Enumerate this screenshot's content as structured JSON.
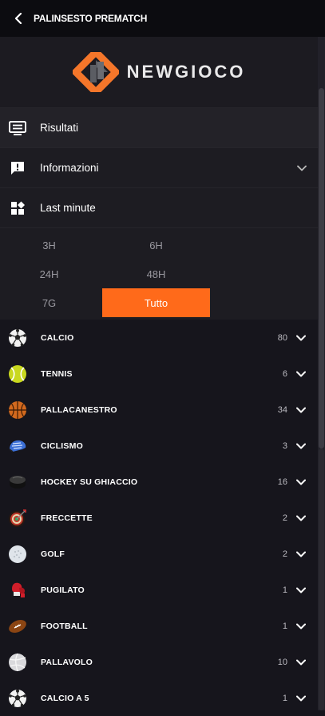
{
  "header": {
    "title": "PALINSESTO PREMATCH",
    "back_icon": "chevron-left-icon"
  },
  "logo": {
    "text": "NEWGIOCO",
    "colors": {
      "orange": "#f4762a",
      "gray": "#5b5d63"
    }
  },
  "menu": [
    {
      "label": "Risultati",
      "icon": "monitor-list-icon"
    },
    {
      "label": "Informazioni",
      "icon": "alert-message-icon",
      "expandable": true
    },
    {
      "label": "Last minute",
      "icon": "grid-add-icon"
    }
  ],
  "filters": {
    "rows": [
      [
        "3H",
        "6H"
      ],
      [
        "24H",
        "48H"
      ],
      [
        "7G",
        "Tutto"
      ]
    ],
    "selected": "Tutto",
    "accent": "#ff6a1a"
  },
  "sports": [
    {
      "name": "CALCIO",
      "count": "80",
      "icon": "soccer-ball-icon"
    },
    {
      "name": "TENNIS",
      "count": "6",
      "icon": "tennis-ball-icon"
    },
    {
      "name": "PALLACANESTRO",
      "count": "34",
      "icon": "basketball-icon"
    },
    {
      "name": "CICLISMO",
      "count": "3",
      "icon": "cycling-helmet-icon"
    },
    {
      "name": "HOCKEY SU GHIACCIO",
      "count": "16",
      "icon": "hockey-puck-icon"
    },
    {
      "name": "FRECCETTE",
      "count": "2",
      "icon": "dartboard-icon"
    },
    {
      "name": "GOLF",
      "count": "2",
      "icon": "golf-ball-icon"
    },
    {
      "name": "PUGILATO",
      "count": "1",
      "icon": "boxing-glove-icon"
    },
    {
      "name": "FOOTBALL",
      "count": "1",
      "icon": "american-football-icon"
    },
    {
      "name": "PALLAVOLO",
      "count": "10",
      "icon": "volleyball-icon"
    },
    {
      "name": "CALCIO A 5",
      "count": "1",
      "icon": "futsal-ball-icon"
    }
  ]
}
